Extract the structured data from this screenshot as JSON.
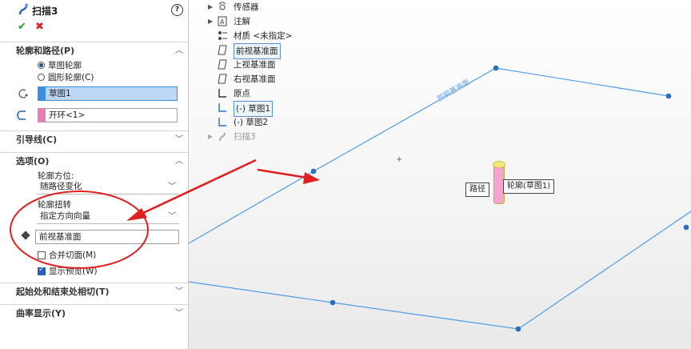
{
  "feature": {
    "title": "扫描3"
  },
  "sections": {
    "profile_path": "轮廓和路径(P)",
    "guides": "引导线(C)",
    "options": "选项(O)",
    "start_end": "起始处和结束处相切(T)",
    "curvature": "曲率显示(Y)"
  },
  "profile_path": {
    "radio_sketch": "草图轮廓",
    "radio_circle": "圆形轮廓(C)",
    "profile_value": "草图1",
    "path_value": "开环<1>"
  },
  "options": {
    "orientation_label": "轮廓方位:",
    "orientation_value": "随路径变化",
    "twist_label": "轮廓扭转",
    "twist_value": "指定方向向量",
    "direction_value": "前视基准面",
    "merge_faces": "合并切面(M)",
    "show_preview": "显示预览(W)"
  },
  "tree": {
    "items": [
      "传感器",
      "注解",
      "材质 <未指定>",
      "前视基准面",
      "上视基准面",
      "右视基准面",
      "原点",
      "(-) 草图1",
      "(-) 草图2",
      "扫描3"
    ]
  },
  "viewport": {
    "plane_label": "前视基准面",
    "callout_path": "路径",
    "callout_profile": "轮廓(草图1)"
  },
  "colors": {
    "accent_blue": "#3d8ee0",
    "annotation_red": "#e02020",
    "profile_pink": "#f3a6cf"
  }
}
